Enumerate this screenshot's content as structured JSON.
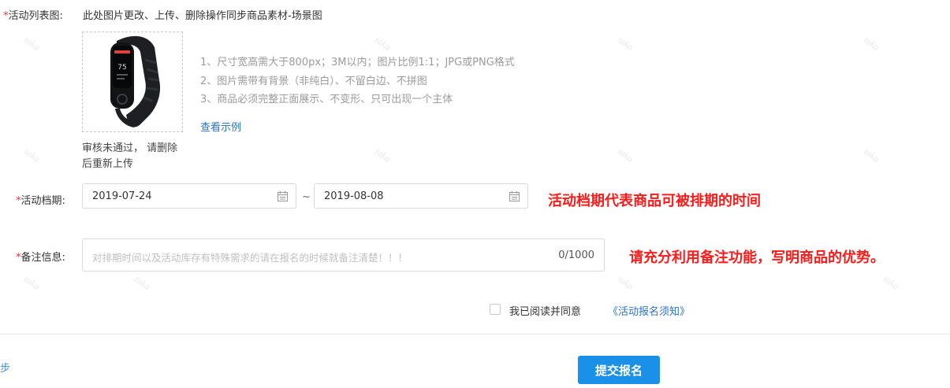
{
  "watermark": "taka",
  "list_image": {
    "required_mark": "*",
    "label": "活动列表图:",
    "hint": "此处图片更改、上传、删除操作同步商品素材-场景图",
    "review_status": "审核未通过， 请删除后重新上传",
    "rules": [
      "1、尺寸宽高需大于800px；3M以内；图片比例1:1；JPG或PNG格式",
      "2、图片需带有背景（非纯白）、不留白边、不拼图",
      "3、商品必须完整正面展示、不变形、只可出现一个主体"
    ],
    "example_link": "查看示例",
    "product_screen_text": "75"
  },
  "schedule": {
    "required_mark": "*",
    "label": "活动档期:",
    "start_date": "2019-07-24",
    "separator": "~",
    "end_date": "2019-08-08",
    "note": "活动档期代表商品可被排期的时间"
  },
  "remark": {
    "required_mark": "*",
    "label": "备注信息:",
    "placeholder": "对排期时间以及活动库存有特殊需求的请在报名的时候就备注清楚！！！",
    "counter": "0/1000",
    "note": "请充分利用备注功能，写明商品的优势。"
  },
  "agreement": {
    "text": "我已阅读并同意",
    "link": "《活动报名须知》"
  },
  "footer": {
    "step_link": "步",
    "submit_label": "提交报名"
  },
  "colors": {
    "required": "#ff2a2a",
    "note_red": "#ff1a1a",
    "link": "#2a73c9",
    "primary_button": "#1a90e8"
  }
}
